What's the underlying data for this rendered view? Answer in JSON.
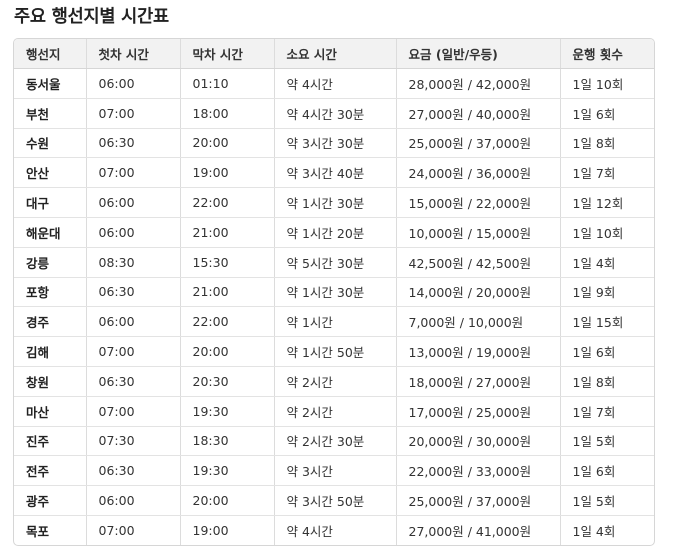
{
  "page_title": "주요 행선지별 시간표",
  "table": {
    "headers": [
      "행선지",
      "첫차 시간",
      "막차 시간",
      "소요 시간",
      "요금 (일반/우등)",
      "운행 횟수"
    ],
    "rows": [
      [
        "동서울",
        "06:00",
        "01:10",
        "약 4시간",
        "28,000원 / 42,000원",
        "1일 10회"
      ],
      [
        "부천",
        "07:00",
        "18:00",
        "약 4시간 30분",
        "27,000원 / 40,000원",
        "1일 6회"
      ],
      [
        "수원",
        "06:30",
        "20:00",
        "약 3시간 30분",
        "25,000원 / 37,000원",
        "1일 8회"
      ],
      [
        "안산",
        "07:00",
        "19:00",
        "약 3시간 40분",
        "24,000원 / 36,000원",
        "1일 7회"
      ],
      [
        "대구",
        "06:00",
        "22:00",
        "약 1시간 30분",
        "15,000원 / 22,000원",
        "1일 12회"
      ],
      [
        "해운대",
        "06:00",
        "21:00",
        "약 1시간 20분",
        "10,000원 / 15,000원",
        "1일 10회"
      ],
      [
        "강릉",
        "08:30",
        "15:30",
        "약 5시간 30분",
        "42,500원 / 42,500원",
        "1일 4회"
      ],
      [
        "포항",
        "06:30",
        "21:00",
        "약 1시간 30분",
        "14,000원 / 20,000원",
        "1일 9회"
      ],
      [
        "경주",
        "06:00",
        "22:00",
        "약 1시간",
        "7,000원 / 10,000원",
        "1일 15회"
      ],
      [
        "김해",
        "07:00",
        "20:00",
        "약 1시간 50분",
        "13,000원 / 19,000원",
        "1일 6회"
      ],
      [
        "창원",
        "06:30",
        "20:30",
        "약 2시간",
        "18,000원 / 27,000원",
        "1일 8회"
      ],
      [
        "마산",
        "07:00",
        "19:30",
        "약 2시간",
        "17,000원 / 25,000원",
        "1일 7회"
      ],
      [
        "진주",
        "07:30",
        "18:30",
        "약 2시간 30분",
        "20,000원 / 30,000원",
        "1일 5회"
      ],
      [
        "전주",
        "06:30",
        "19:30",
        "약 3시간",
        "22,000원 / 33,000원",
        "1일 6회"
      ],
      [
        "광주",
        "06:00",
        "20:00",
        "약 3시간 50분",
        "25,000원 / 37,000원",
        "1일 5회"
      ],
      [
        "목포",
        "07:00",
        "19:00",
        "약 4시간",
        "27,000원 / 41,000원",
        "1일 4회"
      ]
    ]
  }
}
